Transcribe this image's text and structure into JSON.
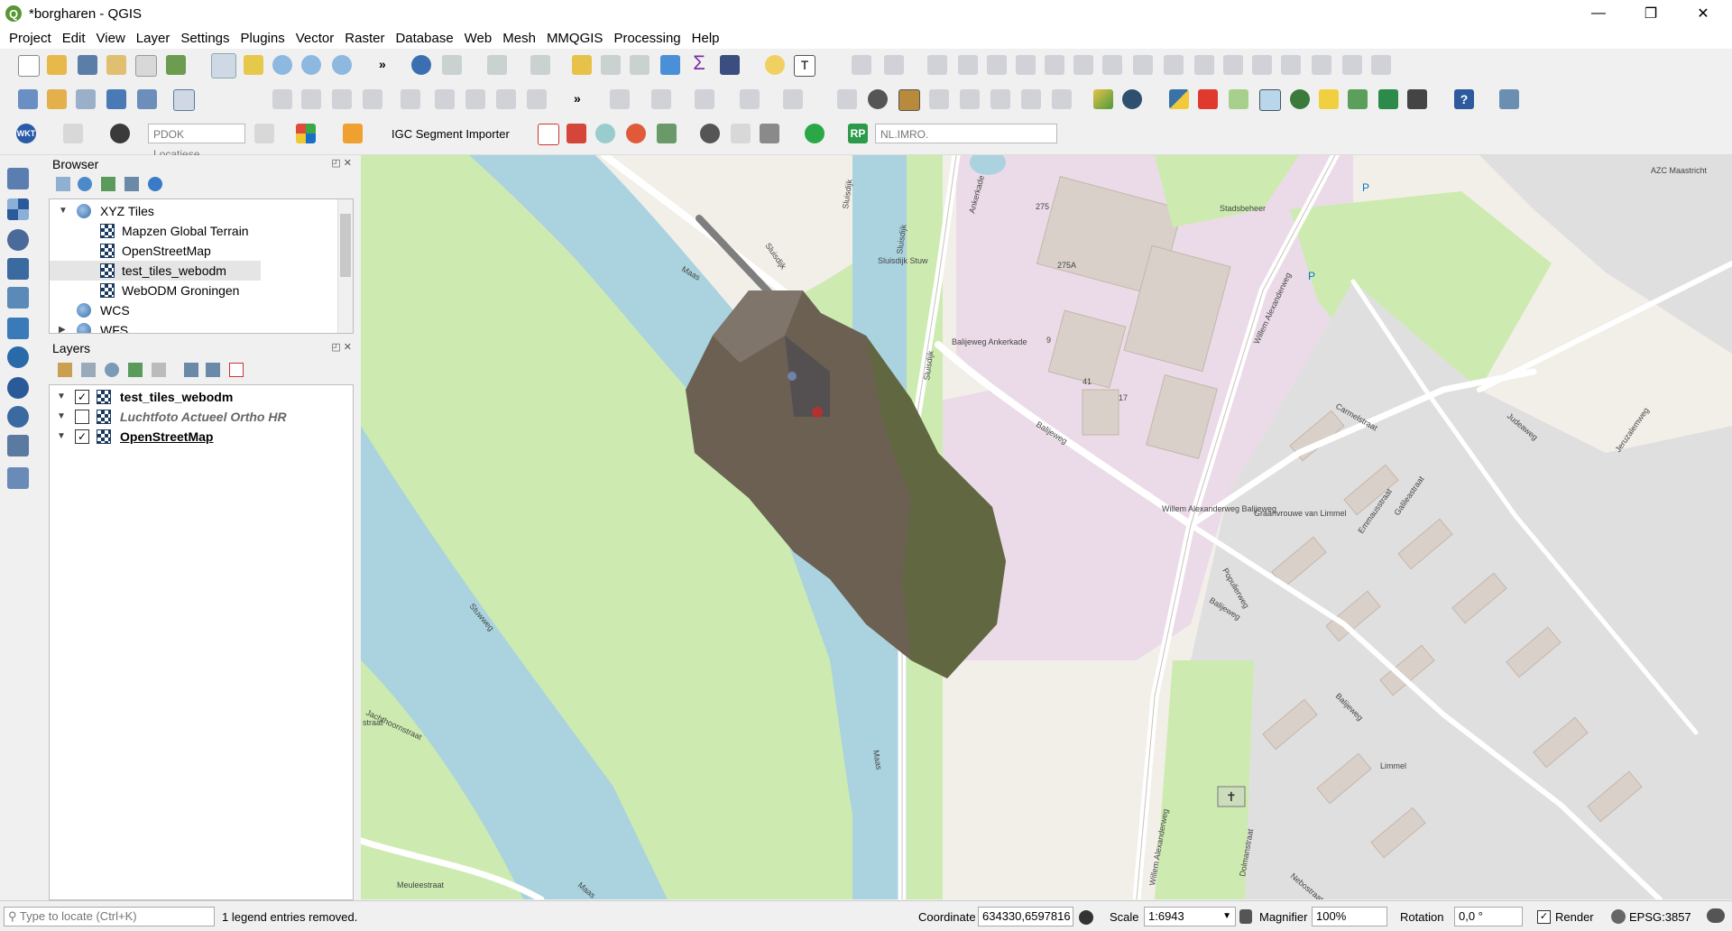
{
  "window": {
    "title": "*borgharen - QGIS",
    "minimize": "—",
    "maximize": "❐",
    "close": "✕"
  },
  "menu": [
    "Project",
    "Edit",
    "View",
    "Layer",
    "Settings",
    "Plugins",
    "Vector",
    "Raster",
    "Database",
    "Web",
    "Mesh",
    "MMQGIS",
    "Processing",
    "Help"
  ],
  "toolbar3": {
    "pdok_placeholder": "PDOK Locatiese...",
    "igc_label": "IGC Segment Importer",
    "rp_label": "RP",
    "imro_placeholder": "NL.IMRO."
  },
  "browser": {
    "title": "Browser",
    "items": [
      {
        "label": "XYZ Tiles",
        "expander": "▼",
        "icon": "globe-icon"
      },
      {
        "label": "Mapzen Global Terrain",
        "icon": "tiles-icon"
      },
      {
        "label": "OpenStreetMap",
        "icon": "tiles-icon"
      },
      {
        "label": "test_tiles_webodm",
        "icon": "tiles-icon",
        "selected": true
      },
      {
        "label": "WebODM Groningen",
        "icon": "tiles-icon"
      },
      {
        "label": "WCS",
        "icon": "globe-icon"
      },
      {
        "label": "WFS",
        "expander": "▶",
        "icon": "globe-icon"
      }
    ]
  },
  "layers": {
    "title": "Layers",
    "items": [
      {
        "label": "test_tiles_webodm",
        "checked": true,
        "style": "bold"
      },
      {
        "label": "Luchtfoto Actueel Ortho HR",
        "checked": false,
        "style": "italic"
      },
      {
        "label": "OpenStreetMap",
        "checked": true,
        "style": "bold-underline"
      }
    ]
  },
  "map_labels": {
    "stadsbeheer": "Stadsbeheer",
    "sluisdijk1": "Sluisdijk",
    "sluisdijk2": "Sluisdijk",
    "sluisdijk3": "Sluisdijk",
    "sluisdijk4": "Sluisdijk",
    "ankerkade": "Ankerkade",
    "willem1": "Willem Alexanderweg",
    "willem2": "Willem Alexanderweg",
    "balijeweg1": "Balijeweg",
    "balijeweg2": "Balijeweg",
    "balijeweg3": "Balijeweg",
    "maas1": "Maas",
    "maas2": "Maas",
    "maas3": "Maas",
    "judeaweg": "Judeaweg",
    "jeruzalemweg": "Jeruzalemweg",
    "carmelstraat": "Carmelstraat",
    "galileastraat": "Galileastraat",
    "emmausstraat": "Emmausstraat",
    "limmel": "Limmel",
    "populierweg": "Populierweg",
    "jachthoornstraat": "Jachthoornstraat",
    "meuleestraat": "Meuleestraat",
    "stuwweg": "Stuwweg",
    "azc": "AZC Maastricht",
    "graanvrouwe": "Graanvrouwe van Limmel",
    "nebostraat": "Nebostraat",
    "dolmanstraat": "Dolmanstraat",
    "sluis_stuw": "Sluisdijk Stuw",
    "balijeweg_ankerkade": "Balijeweg Ankerkade",
    "willem_bus": "Willem Alexanderweg Balijeweg",
    "straat": "straat",
    "n275": "275",
    "n275a": "275A",
    "n17": "17",
    "n41": "41",
    "n9": "9"
  },
  "status": {
    "locate_placeholder": "Type to locate (Ctrl+K)",
    "message": "1 legend entries removed.",
    "coordinate_label": "Coordinate",
    "coordinate_value": "634330,6597816",
    "scale_label": "Scale",
    "scale_value": "1:6943",
    "magnifier_label": "Magnifier",
    "magnifier_value": "100%",
    "rotation_label": "Rotation",
    "rotation_value": "0,0 °",
    "render_label": "Render",
    "render_checked": "✓",
    "crs": "EPSG:3857",
    "messages_icon": "speech-bubble-icon"
  },
  "colors": {
    "water": "#aad3df",
    "grass": "#cdebb0",
    "industrial": "#ebdbe8",
    "residential": "#e0dfdf",
    "building": "#d9d0c9",
    "road": "#ffffff",
    "highlight_row": "#e5e5e5"
  }
}
